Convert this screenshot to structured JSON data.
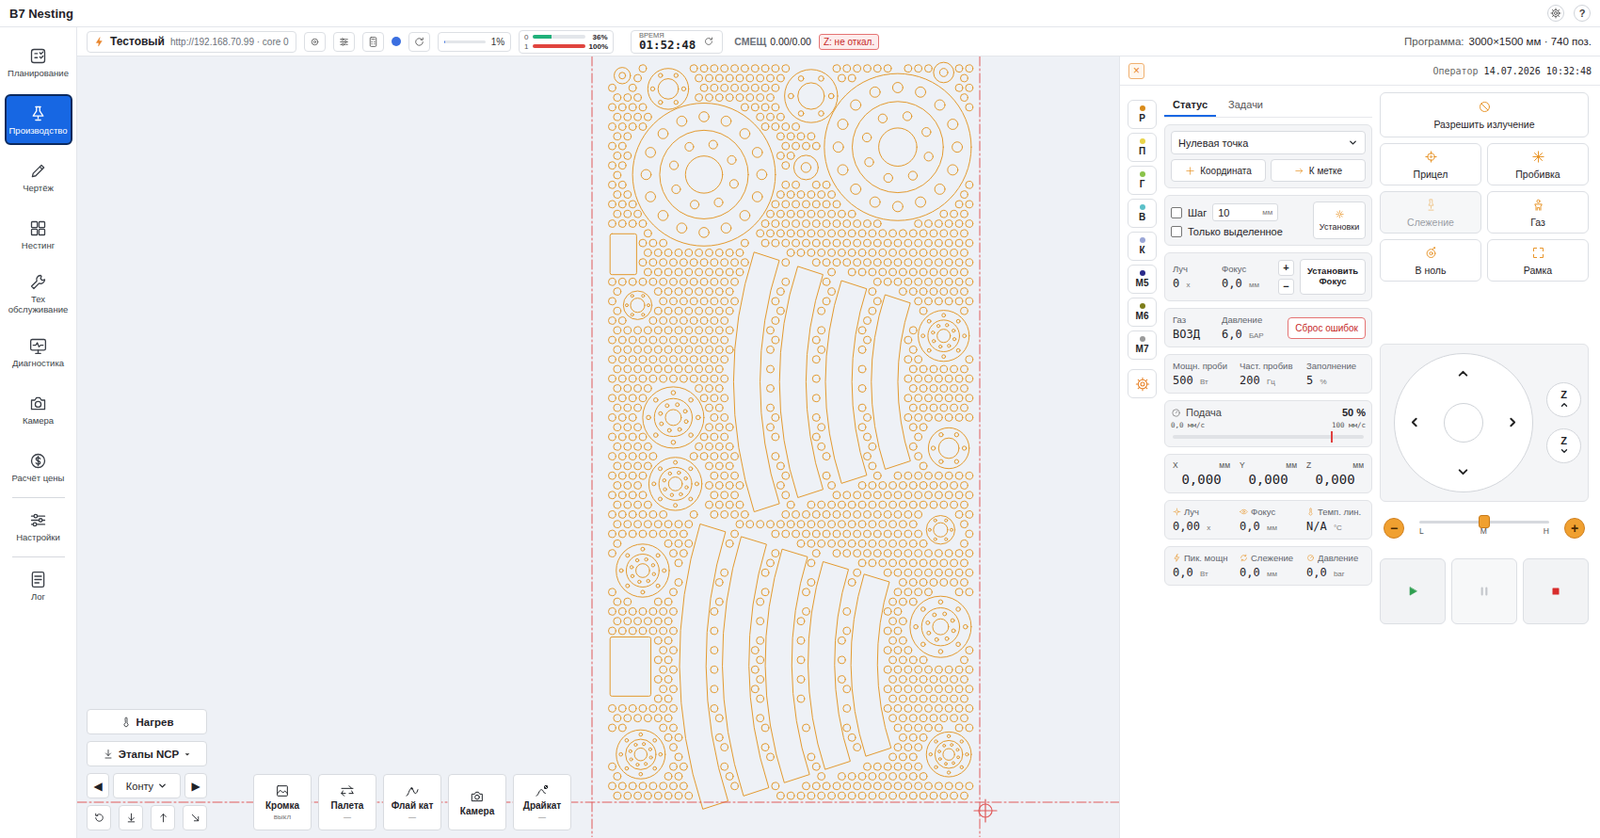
{
  "header": {
    "title": "B7 Nesting",
    "help": "?"
  },
  "sidebar": {
    "items": [
      {
        "label": "Планирование",
        "selected": false
      },
      {
        "label": "Производство",
        "selected": true
      },
      {
        "label": "Чертёж",
        "selected": false
      },
      {
        "label": "Нестинг",
        "selected": false
      },
      {
        "label": "Тех обслуживание",
        "selected": false
      },
      {
        "label": "Диагностика",
        "selected": false
      },
      {
        "label": "Камера",
        "selected": false
      },
      {
        "label": "Расчёт цены",
        "selected": false
      },
      {
        "label": "Настройки",
        "selected": false
      },
      {
        "label": "Лог",
        "selected": false
      }
    ]
  },
  "toolbar": {
    "machine": {
      "name": "Тестовый",
      "address": "http://192.168.70.99 · core 0"
    },
    "progress": {
      "reading": "1%",
      "level": 0.01
    },
    "heads": [
      {
        "label": "0",
        "reading": "36%",
        "level": 0.36,
        "color": "#20b07a"
      },
      {
        "label": "1",
        "reading": "100%",
        "level": 1,
        "color": "#e0443e"
      }
    ],
    "time": {
      "label": "ВРЕМЯ",
      "value": "01:52:48"
    },
    "offset": {
      "label": "СМЕЩ",
      "value": "0.00/0.00"
    },
    "z_badge": "Z: не откал.",
    "program": {
      "label": "Программа:",
      "value": "3000×1500 мм · 740 поз."
    }
  },
  "canvas": {
    "heat": "Нагрев",
    "stages": "Этапы NCP",
    "prev": "◀",
    "next": "▶",
    "contour": "Конту",
    "tiles": [
      {
        "label": "Кромка",
        "sub": "выкл"
      },
      {
        "label": "Палета",
        "sub": "—"
      },
      {
        "label": "Флай кат",
        "sub": "—"
      },
      {
        "label": "Камера"
      },
      {
        "label": "Драйкат",
        "sub": "—"
      }
    ]
  },
  "panel": {
    "close": "×",
    "operator": {
      "label": "Оператор",
      "datetime": "14.07.2026 10:32:48"
    },
    "layers": [
      {
        "label": "Р",
        "color": "#d98b1a"
      },
      {
        "label": "П",
        "color": "#e8d44a"
      },
      {
        "label": "Г",
        "color": "#8bc34a"
      },
      {
        "label": "В",
        "color": "#5bc0c8"
      },
      {
        "label": "К",
        "color": "#9aa6d6"
      },
      {
        "label": "М5",
        "color": "#2a2a8a"
      },
      {
        "label": "М6",
        "color": "#7d7d1a"
      },
      {
        "label": "М7",
        "color": "#9a9a9a"
      }
    ],
    "tabs": [
      {
        "label": "Статус",
        "selected": true
      },
      {
        "label": "Задачи",
        "selected": false
      }
    ],
    "zero_select": "Нулевая точка",
    "coord_buttons": [
      "Координата",
      "К метке"
    ],
    "step": {
      "label": "Шаг",
      "checked": false,
      "value": "10",
      "unit": "мм"
    },
    "only_selected": {
      "label": "Только выделенное",
      "checked": false
    },
    "settings_button": "Установки",
    "beam": [
      {
        "label": "Луч",
        "value": "0",
        "unit": "х"
      },
      {
        "label": "Фокус",
        "value": "0,0",
        "unit": "мм"
      }
    ],
    "plus": "+",
    "minus": "−",
    "set_focus": "Установить Фокус",
    "gas": [
      {
        "label": "Газ",
        "value": "ВОЗД",
        "unit": ""
      },
      {
        "label": "Давление",
        "value": "6,0",
        "unit": "БАР"
      }
    ],
    "reset": "Сброс ошибок",
    "pierce": [
      {
        "label": "Мощн. проби",
        "value": "500",
        "unit": "Вт"
      },
      {
        "label": "Част. пробив",
        "value": "200",
        "unit": "Гц"
      },
      {
        "label": "Заполнение",
        "value": "5",
        "unit": "%"
      }
    ],
    "feed": {
      "label": "Подача",
      "value": "50 %",
      "min": "0,0 мм/с",
      "max": "100 мм/с",
      "level": 0.83
    },
    "coords": [
      {
        "label": "X",
        "unit": "мм",
        "value": "0,000"
      },
      {
        "label": "Y",
        "unit": "мм",
        "value": "0,000"
      },
      {
        "label": "Z",
        "unit": "мм",
        "value": "0,000"
      }
    ],
    "sensors": [
      [
        {
          "label": "Луч",
          "value": "0,00",
          "unit": "х"
        },
        {
          "label": "Фокус",
          "value": "0,0",
          "unit": "мм"
        },
        {
          "label": "Темп. лин.",
          "value": "N/A",
          "unit": "°C"
        }
      ],
      [
        {
          "label": "Пик. мощн",
          "value": "0,0",
          "unit": "Вт"
        },
        {
          "label": "Слежение",
          "value": "0,0",
          "unit": "мм"
        },
        {
          "label": "Давление",
          "value": "0,0",
          "unit": "bar"
        }
      ]
    ],
    "actions": [
      {
        "label": "Разрешить излучение",
        "disabled": false
      },
      {
        "label": "Прицел",
        "disabled": false
      },
      {
        "label": "Пробивка",
        "disabled": false
      },
      {
        "label": "Слежение",
        "disabled": true
      },
      {
        "label": "Газ",
        "disabled": false
      },
      {
        "label": "В ноль",
        "disabled": false
      },
      {
        "label": "Рамка",
        "disabled": false
      }
    ],
    "jog": {
      "z_up": "Z",
      "z_down": "Z"
    },
    "speed": {
      "minus": "−",
      "plus": "+",
      "marks": [
        "L",
        "M",
        "H"
      ],
      "level": 0.5
    },
    "run": [
      {
        "kind": "start",
        "disabled": false
      },
      {
        "kind": "pause",
        "disabled": true
      },
      {
        "kind": "stop",
        "disabled": false
      }
    ]
  }
}
